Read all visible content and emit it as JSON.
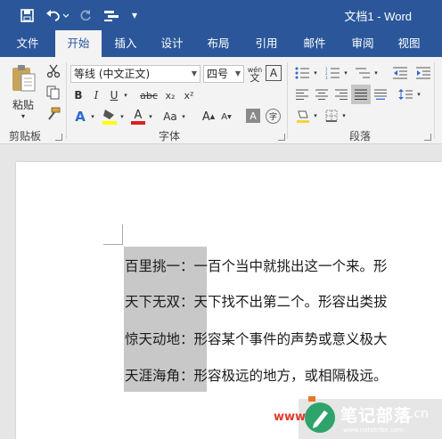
{
  "window": {
    "title": "文档1 - Word"
  },
  "qat": {
    "customize": "▾"
  },
  "tabs": [
    "文件",
    "开始",
    "插入",
    "设计",
    "布局",
    "引用",
    "邮件",
    "审阅",
    "视图"
  ],
  "active_tab": "开始",
  "clipboard": {
    "paste_label": "粘贴",
    "group_label": "剪贴板"
  },
  "font": {
    "name": "等线 (中文正文)",
    "size": "四号",
    "wen_top": "wén",
    "wen_bottom": "文",
    "border_char": "A",
    "bold": "B",
    "italic": "I",
    "underline": "U",
    "strike": "abc",
    "subscript": "x₂",
    "superscript": "x²",
    "grow": "A",
    "shrink": "A",
    "change_case": "Aa",
    "shade_char": "A",
    "enclose_char": "字",
    "group_label": "字体"
  },
  "paragraph": {
    "group_label": "段落"
  },
  "document": {
    "lines": [
      {
        "term": "百里挑一",
        "sep": "：",
        "def": "一百个当中就挑出这一个来。形"
      },
      {
        "term": "天下无双",
        "sep": "：",
        "def": "天下找不出第二个。形容出类拔"
      },
      {
        "term": "惊天动地",
        "sep": "：",
        "def": "形容某个事件的声势或意义极大"
      },
      {
        "term": "天涯海角",
        "sep": "：",
        "def": "形容极远的地方，或相隔极远。"
      }
    ]
  },
  "watermark": {
    "name": "笔记部落",
    "suffix": ".cn",
    "url": "www.notetribe.com",
    "www": "www"
  },
  "colors": {
    "brand": "#2b579a",
    "highlight": "#ffff00",
    "font_color": "#e02020",
    "selection": "#c8c8c8"
  }
}
